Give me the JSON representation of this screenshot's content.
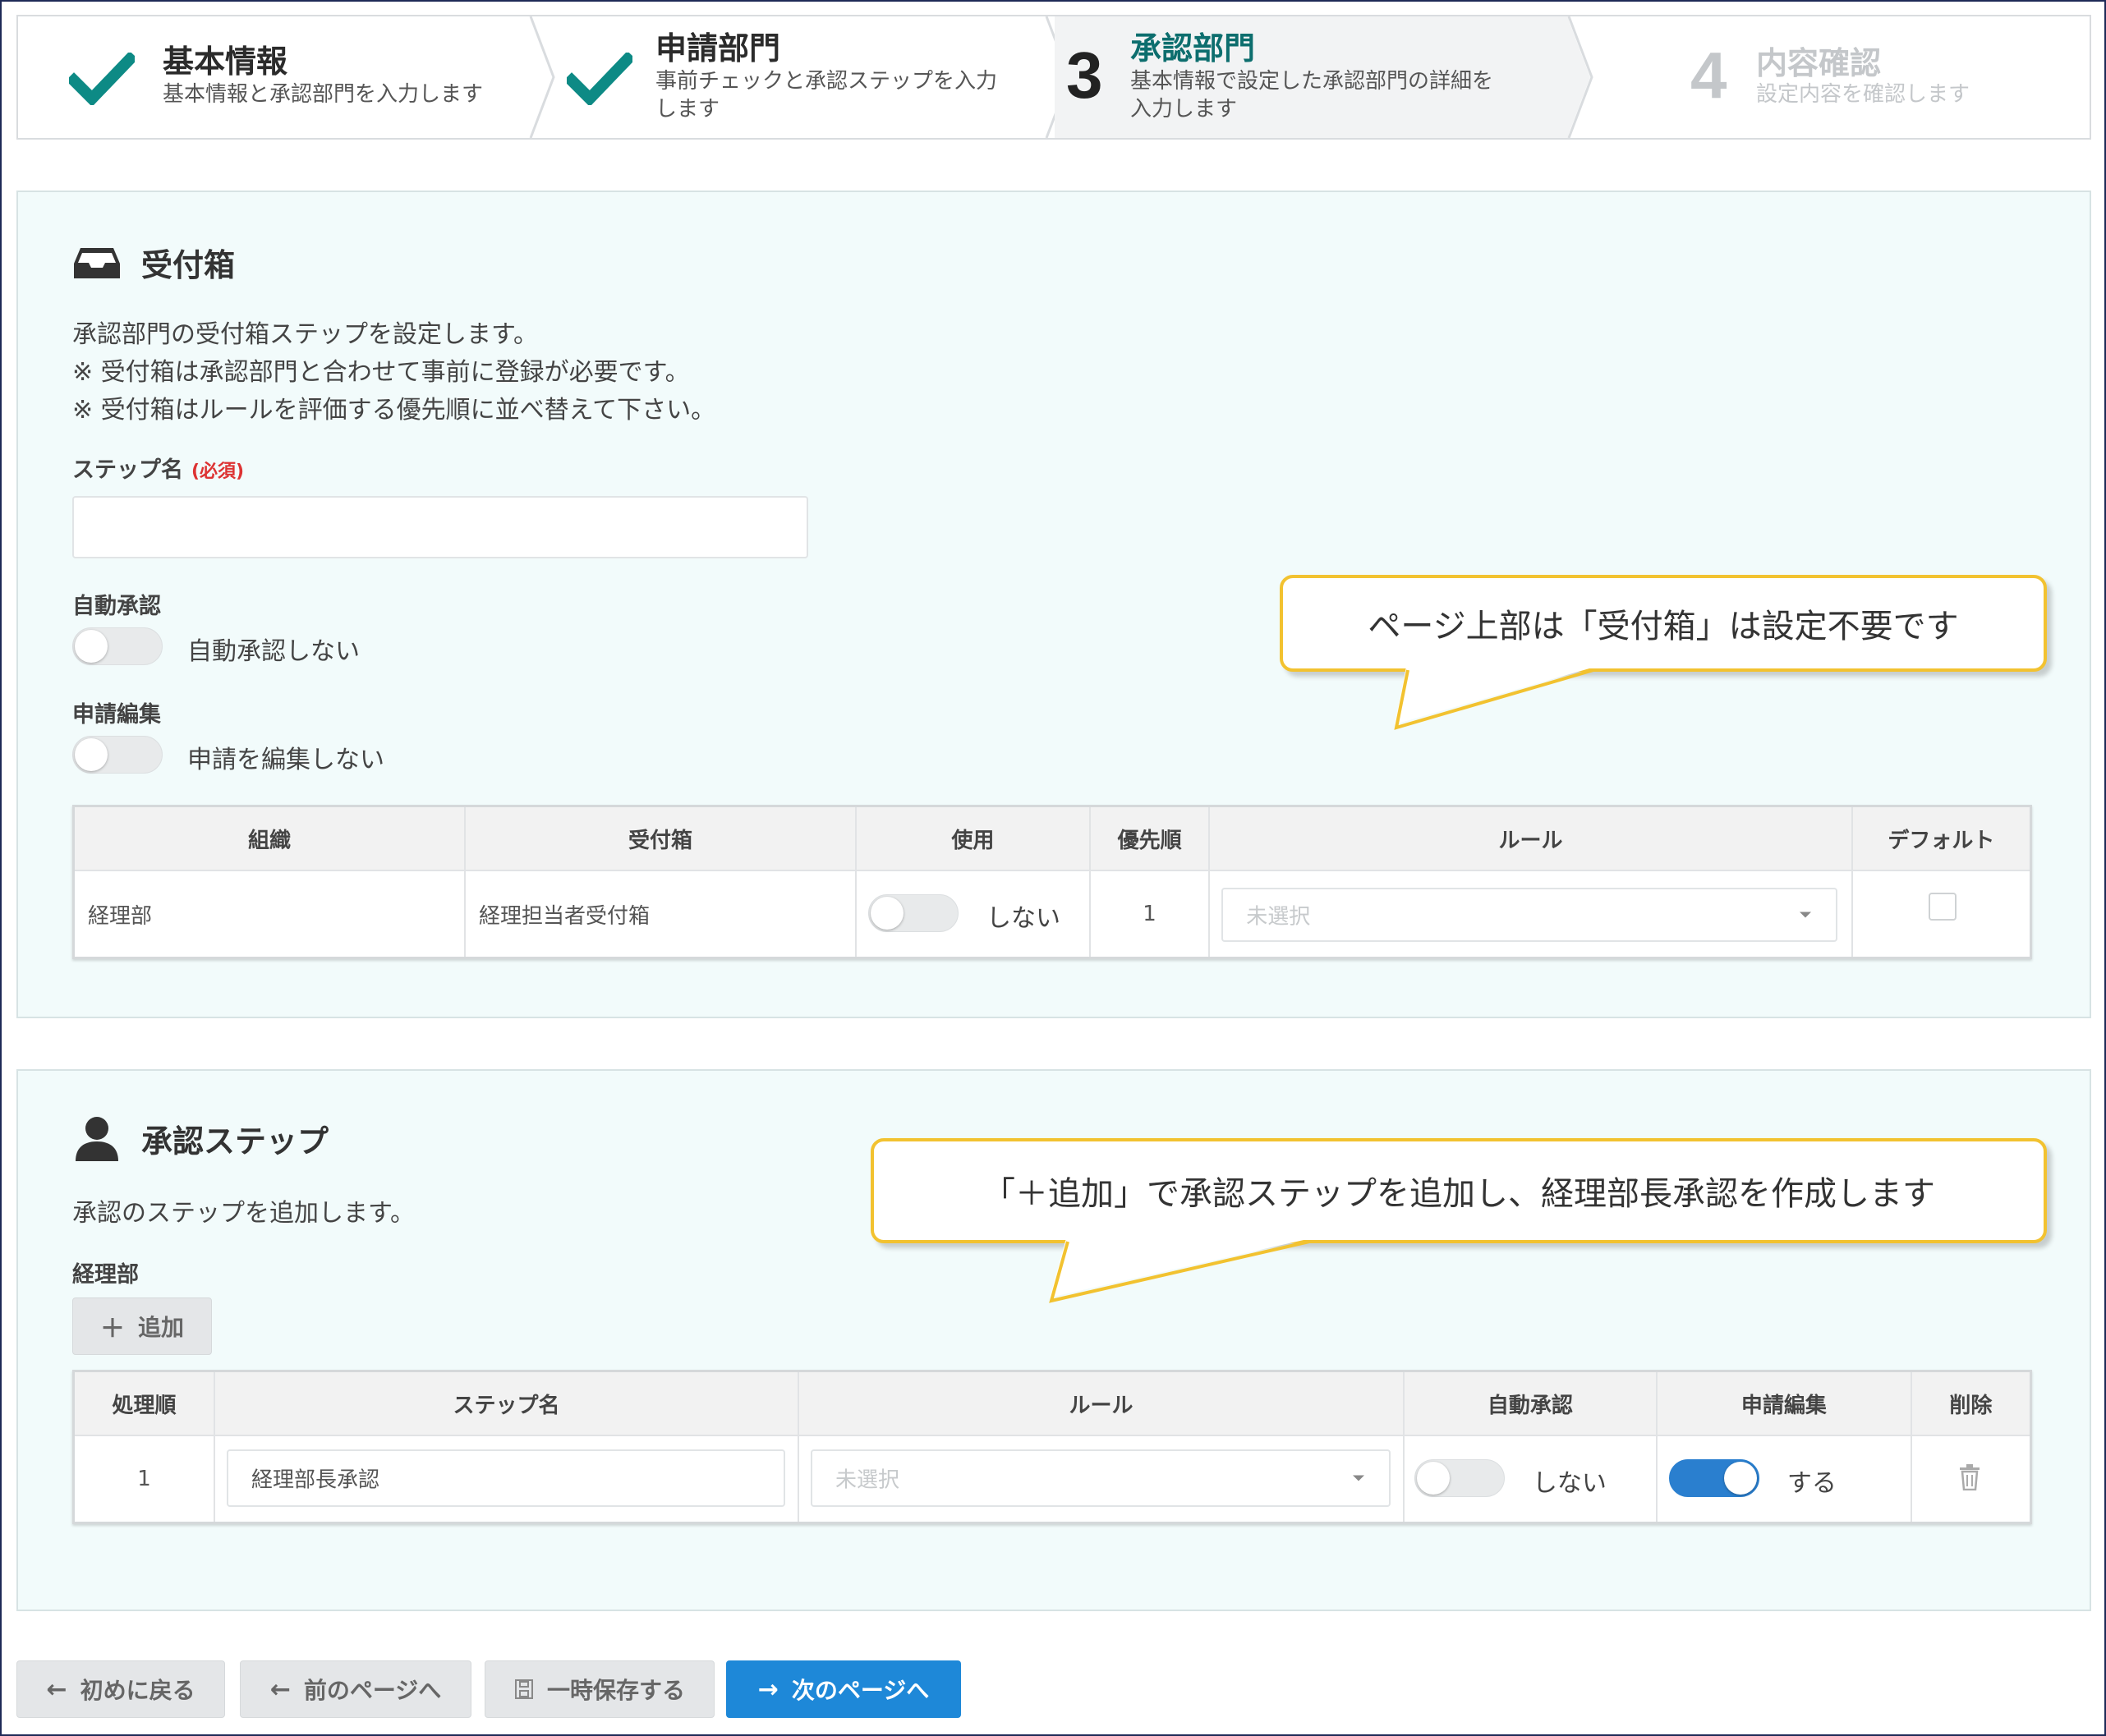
{
  "stepper": {
    "steps": [
      {
        "title": "基本情報",
        "desc": "基本情報と承認部門を入力します",
        "state": "done"
      },
      {
        "title": "申請部門",
        "desc1": "事前チェックと承認ステップを入力",
        "desc2": "します",
        "state": "done"
      },
      {
        "number": "3",
        "title": "承認部門",
        "desc1": "基本情報で設定した承認部門の詳細を",
        "desc2": "入力します",
        "state": "active"
      },
      {
        "number": "4",
        "title": "内容確認",
        "desc": "設定内容を確認します",
        "state": "todo"
      }
    ]
  },
  "inbox": {
    "title": "受付箱",
    "icon": "inbox-icon",
    "desc": [
      "承認部門の受付箱ステップを設定します。",
      "※ 受付箱は承認部門と合わせて事前に登録が必要です。",
      "※ 受付箱はルールを評価する優先順に並べ替えて下さい。"
    ],
    "step_name_label": "ステップ名",
    "required_label": "(必須)",
    "step_name_value": "",
    "auto_approve_label": "自動承認",
    "auto_approve_toggle_label": "自動承認しない",
    "edit_label": "申請編集",
    "edit_toggle_label": "申請を編集しない",
    "table": {
      "headers": [
        "組織",
        "受付箱",
        "使用",
        "優先順",
        "ルール",
        "デフォルト"
      ],
      "row": {
        "org": "経理部",
        "inbox": "経理担当者受付箱",
        "use_label": "しない",
        "priority": "1",
        "rule_placeholder": "未選択"
      }
    }
  },
  "approval": {
    "title": "承認ステップ",
    "icon": "user-icon",
    "desc": "承認のステップを追加します。",
    "group_label": "経理部",
    "add_button": "追加",
    "table": {
      "headers": [
        "処理順",
        "ステップ名",
        "ルール",
        "自動承認",
        "申請編集",
        "削除"
      ],
      "row": {
        "order": "1",
        "step_name": "経理部長承認",
        "rule_placeholder": "未選択",
        "auto_label": "しない",
        "edit_label": "する"
      }
    }
  },
  "callouts": {
    "top": "ページ上部は「受付箱」は設定不要です",
    "bottom": "「＋追加」で承認ステップを追加し、経理部長承認を作成します"
  },
  "footer": {
    "back_to_start": "初めに戻る",
    "prev_page": "前のページへ",
    "save_temp": "一時保存する",
    "next_page": "次のページへ"
  },
  "colors": {
    "accent_teal": "#0d8a85",
    "primary_blue": "#1e88d8",
    "callout_border": "#f2c230",
    "required_red": "#dd3333"
  }
}
